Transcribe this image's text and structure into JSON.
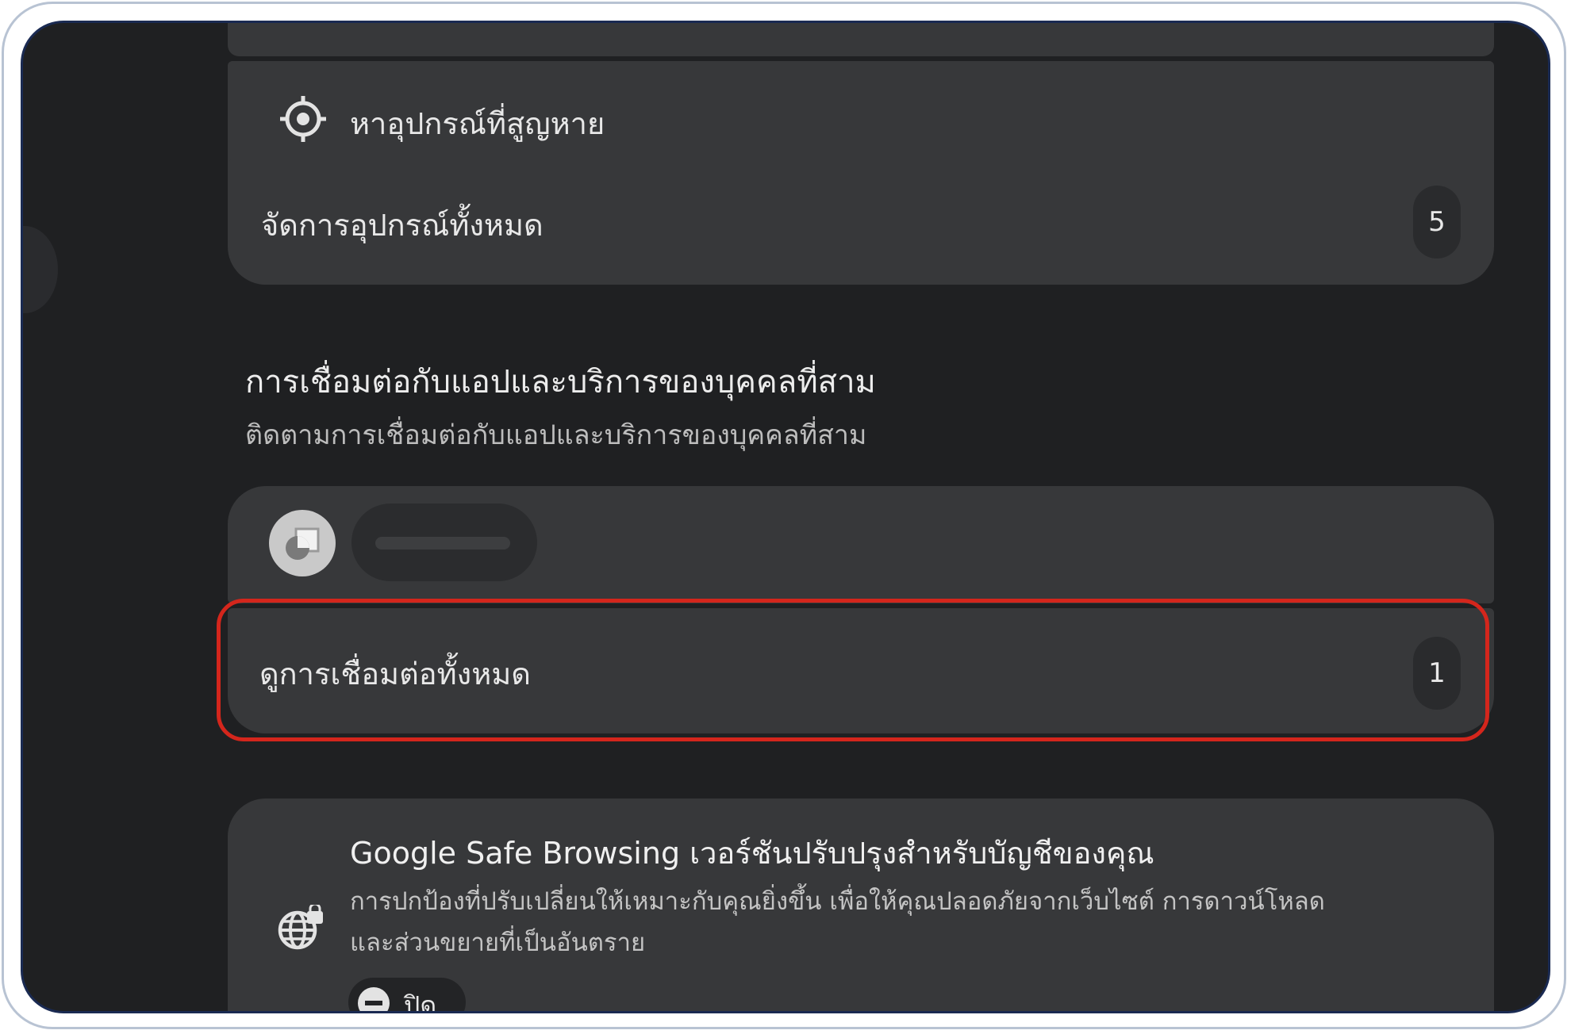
{
  "find_device": {
    "label": "หาอุปกรณ์ที่สูญหาย",
    "icon": "target-icon"
  },
  "manage_devices": {
    "label": "จัดการอุปกรณ์ทั้งหมด",
    "count": "5"
  },
  "third_party": {
    "title": "การเชื่อมต่อกับแอปและบริการของบุคคลที่สาม",
    "subtitle": "ติดตามการเชื่อมต่อกับแอปและบริการของบุคคลที่สาม",
    "app_icon": "app-logo-icon",
    "view_all_label": "ดูการเชื่อมต่อทั้งหมด",
    "view_all_count": "1"
  },
  "safe_browsing": {
    "title": "Google Safe Browsing เวอร์ชันปรับปรุงสำหรับบัญชีของคุณ",
    "desc_line1": "การปกป้องที่ปรับเปลี่ยนให้เหมาะกับคุณยิ่งขึ้น เพื่อให้คุณปลอดภัยจากเว็บไซต์ การดาวน์โหลด",
    "desc_line2": "และส่วนขยายที่เป็นอันตราย",
    "status_label": "ปิด",
    "icon": "globe-lock-icon",
    "status_icon": "minus-circle-icon"
  },
  "colors": {
    "background": "#1f2022",
    "card": "#37383a",
    "highlight": "#d4261c"
  }
}
